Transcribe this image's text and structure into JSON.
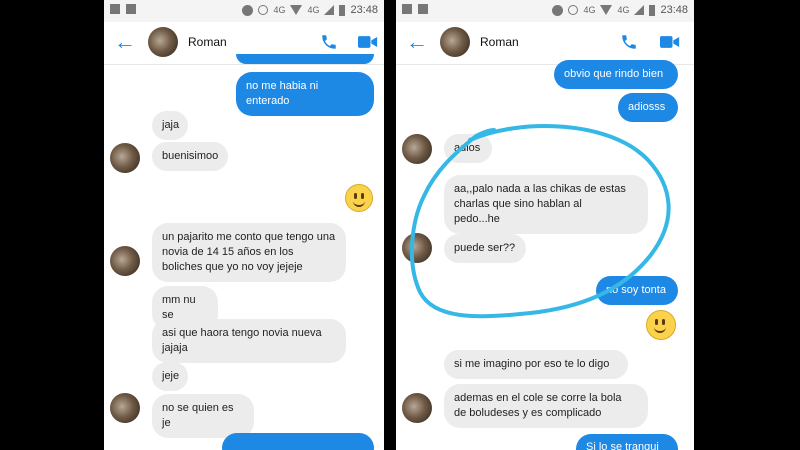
{
  "status": {
    "network": "4G",
    "time": "23:48"
  },
  "contact": {
    "name": "Roman"
  },
  "left": {
    "messages": [
      {
        "from": "me",
        "text": "no me habia ni enterado"
      },
      {
        "from": "them",
        "text": "jaja"
      },
      {
        "from": "them",
        "text": "buenisimoo"
      },
      {
        "from": "me",
        "emoji": "smiley"
      },
      {
        "from": "them",
        "text": "un pajarito me conto que tengo una\nnovia  de 14 15 años en los\nboliches que yo no voy jejeje"
      },
      {
        "from": "them",
        "text": "mm nu se"
      },
      {
        "from": "them",
        "text": "asi que haora tengo novia nueva\njajaja"
      },
      {
        "from": "them",
        "text": "jeje"
      },
      {
        "from": "them",
        "text": "no se quien es je"
      }
    ]
  },
  "right": {
    "messages": [
      {
        "from": "me",
        "text": "obvio que rindo bien"
      },
      {
        "from": "me",
        "text": "adiosss"
      },
      {
        "from": "them",
        "text": "adios"
      },
      {
        "from": "them",
        "text": "aa,,palo nada a las chikas de estas\ncharlas que sino hablan al\npedo...he"
      },
      {
        "from": "them",
        "text": "puede ser??"
      },
      {
        "from": "me",
        "text": "no soy tonta"
      },
      {
        "from": "me",
        "emoji": "smiley"
      },
      {
        "from": "them",
        "text": "si me imagino por eso te lo digo"
      },
      {
        "from": "them",
        "text": "ademas en el cole se corre la bola\nde boludeses y es complicado"
      },
      {
        "from": "me",
        "text": "Si lo se tranqui"
      }
    ]
  },
  "colors": {
    "accent": "#1e88e5",
    "incoming": "#ececec",
    "annotation": "#35b8e6"
  }
}
